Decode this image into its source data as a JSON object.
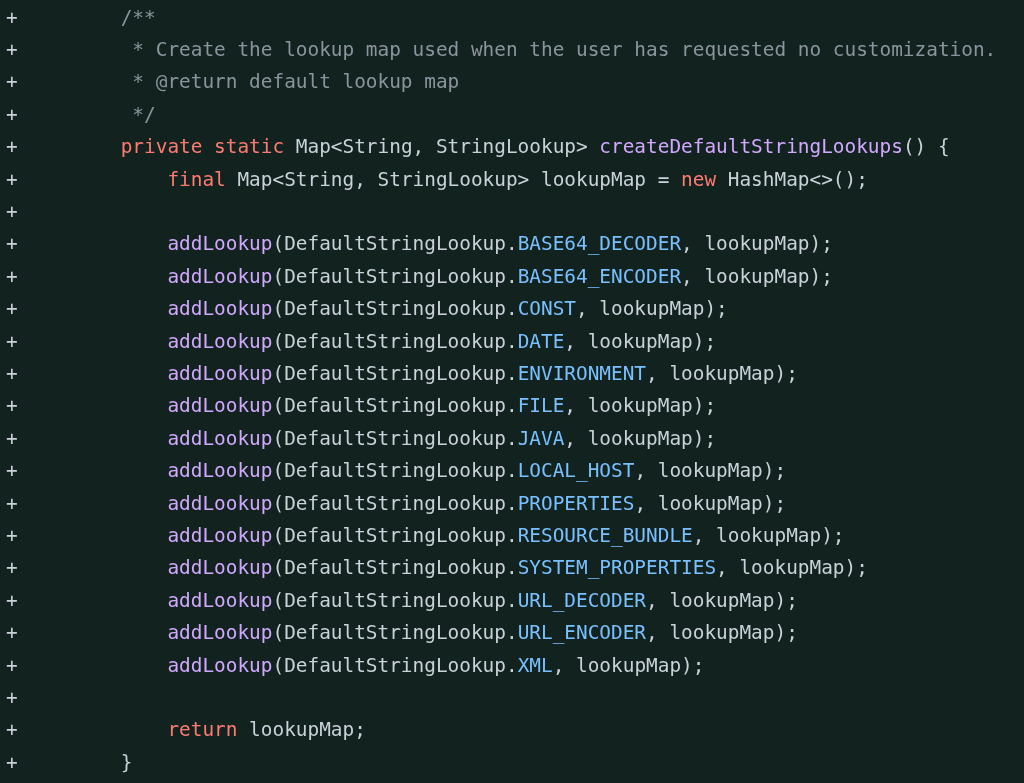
{
  "diff_lines": [
    {
      "marker": "+",
      "tokens": [
        {
          "text": "/**",
          "kind": "comment"
        }
      ]
    },
    {
      "marker": "+",
      "tokens": [
        {
          "text": " * Create the lookup map used when the user has requested no customization.",
          "kind": "comment"
        }
      ]
    },
    {
      "marker": "+",
      "tokens": [
        {
          "text": " * @return default lookup map",
          "kind": "comment"
        }
      ]
    },
    {
      "marker": "+",
      "tokens": [
        {
          "text": " */",
          "kind": "comment"
        }
      ]
    },
    {
      "marker": "+",
      "tokens": [
        {
          "text": "private static",
          "kind": "keyword"
        },
        {
          "text": " Map<String, StringLookup> ",
          "kind": "plain"
        },
        {
          "text": "createDefaultStringLookups",
          "kind": "function"
        },
        {
          "text": "() {",
          "kind": "plain"
        }
      ]
    },
    {
      "marker": "+",
      "tokens": [
        {
          "text": "    final",
          "kind": "keyword"
        },
        {
          "text": " Map<String, StringLookup> lookupMap = ",
          "kind": "plain"
        },
        {
          "text": "new",
          "kind": "keyword"
        },
        {
          "text": " HashMap<>();",
          "kind": "plain"
        }
      ]
    },
    {
      "marker": "+"
    },
    {
      "marker": "+",
      "tokens": [
        {
          "text": "    addLookup",
          "kind": "function"
        },
        {
          "text": "(DefaultStringLookup.",
          "kind": "plain"
        },
        {
          "text": "BASE64_DECODER",
          "kind": "constant"
        },
        {
          "text": ", lookupMap);",
          "kind": "plain"
        }
      ]
    },
    {
      "marker": "+",
      "tokens": [
        {
          "text": "    addLookup",
          "kind": "function"
        },
        {
          "text": "(DefaultStringLookup.",
          "kind": "plain"
        },
        {
          "text": "BASE64_ENCODER",
          "kind": "constant"
        },
        {
          "text": ", lookupMap);",
          "kind": "plain"
        }
      ]
    },
    {
      "marker": "+",
      "tokens": [
        {
          "text": "    addLookup",
          "kind": "function"
        },
        {
          "text": "(DefaultStringLookup.",
          "kind": "plain"
        },
        {
          "text": "CONST",
          "kind": "constant"
        },
        {
          "text": ", lookupMap);",
          "kind": "plain"
        }
      ]
    },
    {
      "marker": "+",
      "tokens": [
        {
          "text": "    addLookup",
          "kind": "function"
        },
        {
          "text": "(DefaultStringLookup.",
          "kind": "plain"
        },
        {
          "text": "DATE",
          "kind": "constant"
        },
        {
          "text": ", lookupMap);",
          "kind": "plain"
        }
      ]
    },
    {
      "marker": "+",
      "tokens": [
        {
          "text": "    addLookup",
          "kind": "function"
        },
        {
          "text": "(DefaultStringLookup.",
          "kind": "plain"
        },
        {
          "text": "ENVIRONMENT",
          "kind": "constant"
        },
        {
          "text": ", lookupMap);",
          "kind": "plain"
        }
      ]
    },
    {
      "marker": "+",
      "tokens": [
        {
          "text": "    addLookup",
          "kind": "function"
        },
        {
          "text": "(DefaultStringLookup.",
          "kind": "plain"
        },
        {
          "text": "FILE",
          "kind": "constant"
        },
        {
          "text": ", lookupMap);",
          "kind": "plain"
        }
      ]
    },
    {
      "marker": "+",
      "tokens": [
        {
          "text": "    addLookup",
          "kind": "function"
        },
        {
          "text": "(DefaultStringLookup.",
          "kind": "plain"
        },
        {
          "text": "JAVA",
          "kind": "constant"
        },
        {
          "text": ", lookupMap);",
          "kind": "plain"
        }
      ]
    },
    {
      "marker": "+",
      "tokens": [
        {
          "text": "    addLookup",
          "kind": "function"
        },
        {
          "text": "(DefaultStringLookup.",
          "kind": "plain"
        },
        {
          "text": "LOCAL_HOST",
          "kind": "constant"
        },
        {
          "text": ", lookupMap);",
          "kind": "plain"
        }
      ]
    },
    {
      "marker": "+",
      "tokens": [
        {
          "text": "    addLookup",
          "kind": "function"
        },
        {
          "text": "(DefaultStringLookup.",
          "kind": "plain"
        },
        {
          "text": "PROPERTIES",
          "kind": "constant"
        },
        {
          "text": ", lookupMap);",
          "kind": "plain"
        }
      ]
    },
    {
      "marker": "+",
      "tokens": [
        {
          "text": "    addLookup",
          "kind": "function"
        },
        {
          "text": "(DefaultStringLookup.",
          "kind": "plain"
        },
        {
          "text": "RESOURCE_BUNDLE",
          "kind": "constant"
        },
        {
          "text": ", lookupMap);",
          "kind": "plain"
        }
      ]
    },
    {
      "marker": "+",
      "tokens": [
        {
          "text": "    addLookup",
          "kind": "function"
        },
        {
          "text": "(DefaultStringLookup.",
          "kind": "plain"
        },
        {
          "text": "SYSTEM_PROPERTIES",
          "kind": "constant"
        },
        {
          "text": ", lookupMap);",
          "kind": "plain"
        }
      ]
    },
    {
      "marker": "+",
      "tokens": [
        {
          "text": "    addLookup",
          "kind": "function"
        },
        {
          "text": "(DefaultStringLookup.",
          "kind": "plain"
        },
        {
          "text": "URL_DECODER",
          "kind": "constant"
        },
        {
          "text": ", lookupMap);",
          "kind": "plain"
        }
      ]
    },
    {
      "marker": "+",
      "tokens": [
        {
          "text": "    addLookup",
          "kind": "function"
        },
        {
          "text": "(DefaultStringLookup.",
          "kind": "plain"
        },
        {
          "text": "URL_ENCODER",
          "kind": "constant"
        },
        {
          "text": ", lookupMap);",
          "kind": "plain"
        }
      ]
    },
    {
      "marker": "+",
      "tokens": [
        {
          "text": "    addLookup",
          "kind": "function"
        },
        {
          "text": "(DefaultStringLookup.",
          "kind": "plain"
        },
        {
          "text": "XML",
          "kind": "constant"
        },
        {
          "text": ", lookupMap);",
          "kind": "plain"
        }
      ]
    },
    {
      "marker": "+"
    },
    {
      "marker": "+",
      "tokens": [
        {
          "text": "    return",
          "kind": "keyword"
        },
        {
          "text": " lookupMap;",
          "kind": "plain"
        }
      ]
    },
    {
      "marker": "+",
      "tokens": [
        {
          "text": "}",
          "kind": "plain"
        }
      ]
    }
  ]
}
